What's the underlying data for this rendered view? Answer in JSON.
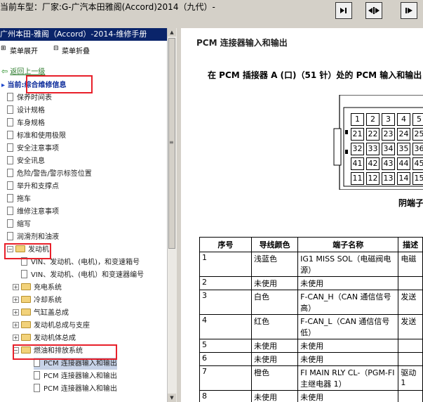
{
  "window": {
    "title": "当前车型：厂家:G-广汽本田雅阁(Accord)2014（九代）-"
  },
  "toolbar": {
    "buttons": [
      {
        "name": "nav-first",
        "icon": "step-icon"
      },
      {
        "name": "nav-swap",
        "icon": "double-arrow-icon"
      },
      {
        "name": "nav-next",
        "icon": "step-right-icon"
      }
    ]
  },
  "sidebar": {
    "title": "广州本田-雅阁（Accord）-2014-维修手册",
    "expand_label": "菜单展开",
    "collapse_label": "菜单折叠",
    "back_label": "返回上一级",
    "current_label": "当前:综合维修信息",
    "items": [
      {
        "label": "保养时间表",
        "type": "doc"
      },
      {
        "label": "设计规格",
        "type": "doc"
      },
      {
        "label": "车身规格",
        "type": "doc"
      },
      {
        "label": "标准和使用极限",
        "type": "doc"
      },
      {
        "label": "安全注意事项",
        "type": "doc"
      },
      {
        "label": "安全讯息",
        "type": "doc"
      },
      {
        "label": "危险/警告/警示标签位置",
        "type": "doc"
      },
      {
        "label": "举升和支撑点",
        "type": "doc"
      },
      {
        "label": "拖车",
        "type": "doc"
      },
      {
        "label": "维修注意事项",
        "type": "doc"
      },
      {
        "label": "缩写",
        "type": "doc"
      },
      {
        "label": "润滑剂和油液",
        "type": "doc"
      },
      {
        "label": "发动机",
        "type": "folder-open"
      },
      {
        "label": "VIN、发动机、(电机)，和变速箱号",
        "type": "doc"
      },
      {
        "label": "VIN、发动机、(电机）和变速器编号",
        "type": "doc"
      },
      {
        "label": "充电系统",
        "type": "folder"
      },
      {
        "label": "冷却系统",
        "type": "folder"
      },
      {
        "label": "气缸盖总成",
        "type": "folder"
      },
      {
        "label": "发动机总成与支座",
        "type": "folder"
      },
      {
        "label": "发动机体总成",
        "type": "folder"
      },
      {
        "label": "燃油和排放系统",
        "type": "folder-open"
      },
      {
        "label": "PCM 连接器输入和输出",
        "type": "doc",
        "selected": true
      },
      {
        "label": "PCM 连接器输入和输出",
        "type": "doc"
      },
      {
        "label": "PCM 连接器输入和输出",
        "type": "doc"
      }
    ]
  },
  "content": {
    "title": "PCM 连接器输入和输出",
    "subtitle": "在 PCM 插接器 A (口)（51 针）处的 PCM 输入和输出",
    "connector_rows": [
      [
        "1",
        "2",
        "3",
        "4",
        "5"
      ],
      [
        "21",
        "22",
        "23",
        "24",
        "25"
      ],
      [
        "32",
        "33",
        "34",
        "35",
        "36"
      ],
      [
        "41",
        "42",
        "43",
        "44",
        "45"
      ],
      [
        "11",
        "12",
        "13",
        "14",
        "15"
      ]
    ],
    "female_label": "阴端子",
    "table": {
      "headers": [
        "序号",
        "导线颜色",
        "端子名称",
        "描述"
      ],
      "rows": [
        [
          "1",
          "浅蓝色",
          "IG1 MISS SOL（电磁阀电源）",
          "电磁"
        ],
        [
          "2",
          "未使用",
          "未使用",
          ""
        ],
        [
          "3",
          "白色",
          "F-CAN_H（CAN 通信信号高）",
          "发送"
        ],
        [
          "4",
          "红色",
          "F-CAN_L（CAN 通信信号低）",
          "发送"
        ],
        [
          "5",
          "未使用",
          "未使用",
          ""
        ],
        [
          "6",
          "未使用",
          "未使用",
          ""
        ],
        [
          "7",
          "橙色",
          "FI MAIN RLY CL-（PGM-FI主继电器 1）",
          "驱动1"
        ],
        [
          "8",
          "未使用",
          "未使用",
          ""
        ]
      ]
    }
  }
}
